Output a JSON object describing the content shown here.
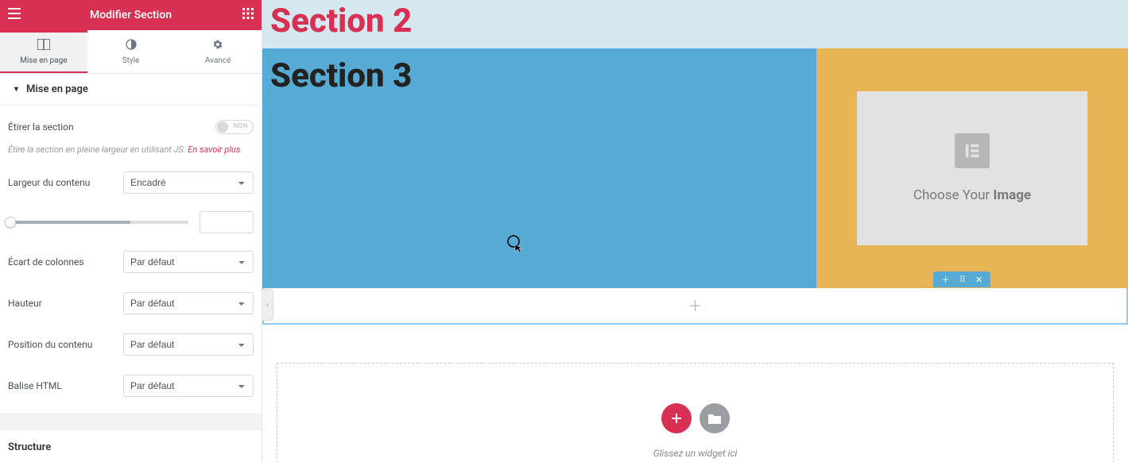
{
  "header": {
    "title": "Modifier Section"
  },
  "tabs": [
    {
      "key": "layout",
      "label": "Mise en page"
    },
    {
      "key": "style",
      "label": "Style"
    },
    {
      "key": "advanced",
      "label": "Avancé"
    }
  ],
  "accordion": {
    "layout_title": "Mise en page"
  },
  "fields": {
    "stretch": {
      "label": "Étirer la section",
      "toggle_label": "NON"
    },
    "stretch_help": "Étire la section en pleine largeur en utilisant JS. ",
    "learn_more": "En savoir plus",
    "content_width": {
      "label": "Largeur du contenu",
      "value": "Encadré"
    },
    "column_gap": {
      "label": "Écart de colonnes",
      "value": "Par défaut"
    },
    "height": {
      "label": "Hauteur",
      "value": "Par défaut"
    },
    "content_position": {
      "label": "Position du contenu",
      "value": "Par défaut"
    },
    "html_tag": {
      "label": "Balise HTML",
      "value": "Par défaut"
    }
  },
  "structure": {
    "heading": "Structure"
  },
  "canvas": {
    "section2_title": "Section 2",
    "section3_title": "Section 3",
    "choose_image_prefix": "Choose Your ",
    "choose_image_bold": "Image",
    "drop_hint": "Glissez un widget ici"
  },
  "colors": {
    "brand": "#d73052",
    "blue": "#56aad4",
    "yellow": "#e8b556",
    "lightblue_strip": "#d5e7ef"
  }
}
